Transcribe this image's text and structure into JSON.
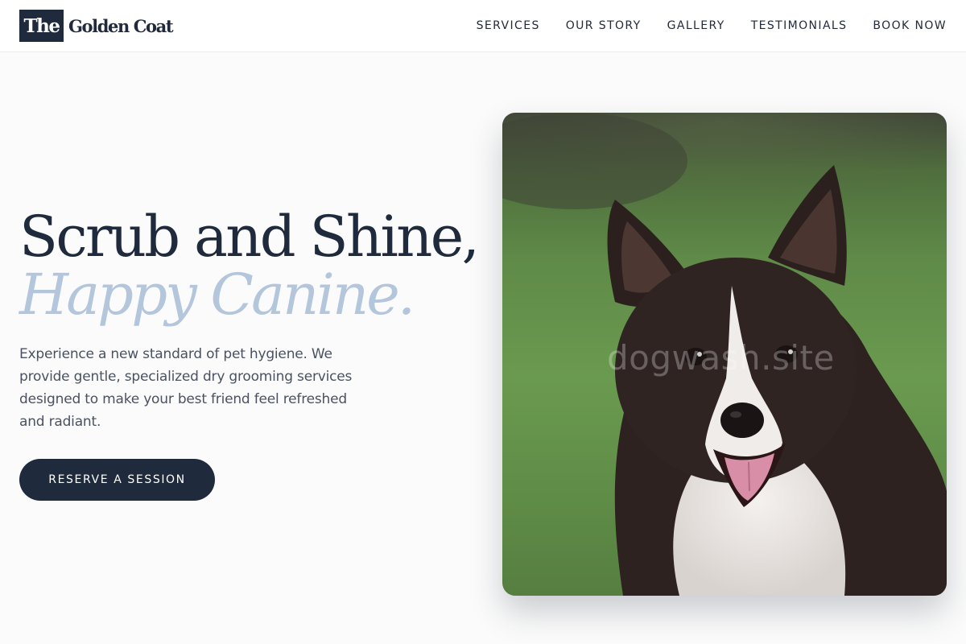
{
  "brand": {
    "mark": "The",
    "name": "Golden Coat"
  },
  "nav": {
    "items": [
      {
        "label": "SERVICES"
      },
      {
        "label": "OUR STORY"
      },
      {
        "label": "GALLERY"
      },
      {
        "label": "TESTIMONIALS"
      },
      {
        "label": "BOOK NOW"
      }
    ]
  },
  "hero": {
    "headline_line1": "Scrub and Shine,",
    "headline_line2": "Happy Canine.",
    "description": "Experience a new standard of pet hygiene. We provide gentle, specialized dry grooming services designed to make your best friend feel refreshed and radiant.",
    "cta_label": "RESERVE A SESSION",
    "image_watermark": "dogwash.site"
  },
  "colors": {
    "primary": "#1f2a3d",
    "accent": "#b3c6dc",
    "background": "#fbfbfb",
    "body_text": "#4a5261"
  }
}
